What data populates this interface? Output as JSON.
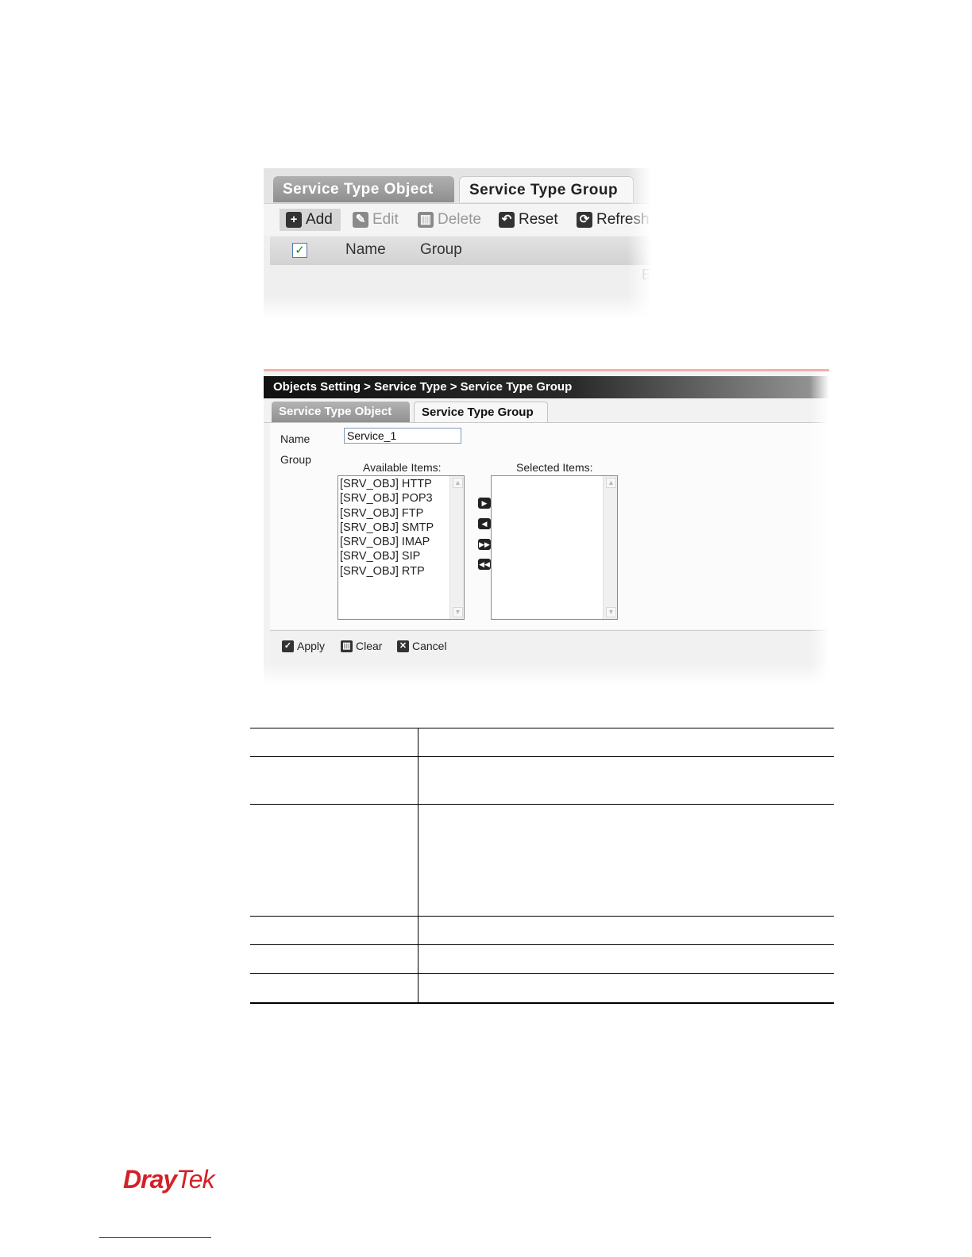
{
  "screenshot1": {
    "tabs": [
      "Service Type Object",
      "Service Type Group"
    ],
    "toolbar": {
      "add": "Add",
      "edit": "Edit",
      "delete": "Delete",
      "reset": "Reset",
      "refresh": "Refresh"
    },
    "columns": [
      "Name",
      "Group"
    ],
    "trailing_text": "E"
  },
  "screenshot2": {
    "breadcrumb": "Objects Setting > Service Type > Service Type Group",
    "tabs": [
      "Service Type Object",
      "Service Type Group"
    ],
    "name_label": "Name",
    "name_value": "Service_1",
    "group_label": "Group",
    "available_label": "Available Items:",
    "selected_label": "Selected Items:",
    "available_items": [
      "[SRV_OBJ] HTTP",
      "[SRV_OBJ] POP3",
      "[SRV_OBJ] FTP",
      "[SRV_OBJ] SMTP",
      "[SRV_OBJ] IMAP",
      "[SRV_OBJ] SIP",
      "[SRV_OBJ] RTP"
    ],
    "selected_items": [],
    "buttons": {
      "apply": "Apply",
      "clear": "Clear",
      "cancel": "Cancel"
    }
  },
  "footer": {
    "logo_dray": "Dray",
    "logo_tek": "Tek"
  }
}
